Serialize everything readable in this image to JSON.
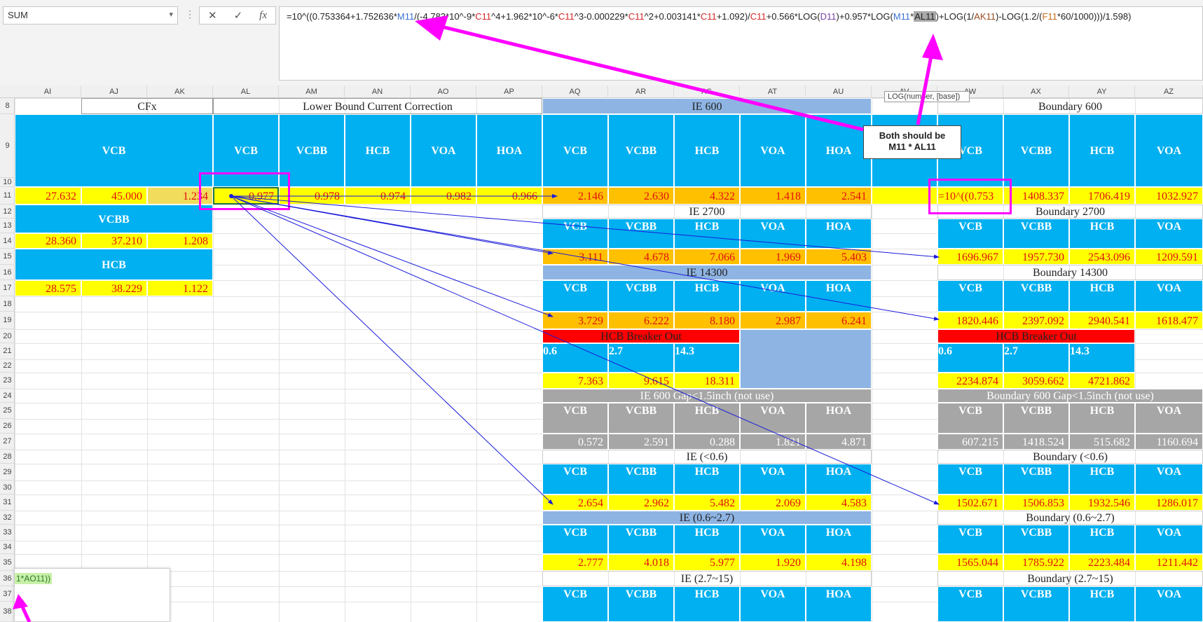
{
  "namebox": {
    "value": "SUM"
  },
  "formula_bar": {
    "cancel_icon": "✕",
    "enter_icon": "✓",
    "fx_icon": "fx",
    "formula_parts": [
      {
        "t": "=10^((0.753364+1.752636*",
        "c": ""
      },
      {
        "t": "M11",
        "c": "fblue"
      },
      {
        "t": "/(-4.783*10^-9*",
        "c": ""
      },
      {
        "t": "C11",
        "c": "fred"
      },
      {
        "t": "^4+1.962*10^-6*",
        "c": ""
      },
      {
        "t": "C11",
        "c": "fred"
      },
      {
        "t": "^3-0.000229*",
        "c": ""
      },
      {
        "t": "C11",
        "c": "fred"
      },
      {
        "t": "^2+0.003141*",
        "c": ""
      },
      {
        "t": "C11",
        "c": "fred"
      },
      {
        "t": "+1.092)/",
        "c": ""
      },
      {
        "t": "C11",
        "c": "fred"
      },
      {
        "t": "+0.566*LOG(",
        "c": ""
      },
      {
        "t": "D11",
        "c": "fpurple"
      },
      {
        "t": ")+0.957*LOG(",
        "c": ""
      },
      {
        "t": "M11",
        "c": "fblue"
      },
      {
        "t": "*",
        "c": ""
      },
      {
        "t": "AL11",
        "c": "fhl"
      },
      {
        "t": ")+LOG(1/",
        "c": ""
      },
      {
        "t": "AK11",
        "c": "fbrown"
      },
      {
        "t": ")-LOG(1.2/(",
        "c": ""
      },
      {
        "t": "F11",
        "c": "forange"
      },
      {
        "t": "*60/1000)))/1.598)",
        "c": ""
      }
    ]
  },
  "tooltip": "LOG(number, [base])",
  "callout": {
    "line1": "Both should be",
    "line2": "M11 * AL11"
  },
  "popup_text": "1*AO11))",
  "columns": [
    "AI",
    "AJ",
    "AK",
    "AL",
    "AM",
    "AN",
    "AO",
    "AP",
    "AQ",
    "AR",
    "AS",
    "AT",
    "AU",
    "AV",
    "AW",
    "AX",
    "AY",
    "AZ"
  ],
  "rows": [
    "8",
    "9",
    "10",
    "11",
    "12",
    "13",
    "14",
    "15",
    "16",
    "17",
    "18",
    "19",
    "20",
    "21",
    "22",
    "23",
    "24",
    "25",
    "26",
    "27",
    "28",
    "29",
    "30",
    "31",
    "32",
    "33",
    "34",
    "35",
    "36",
    "37",
    "38"
  ],
  "sections": {
    "cfx_title": "CFx",
    "lbcc_title": "Lower Bound Current Correction",
    "ie600": "IE 600",
    "boundary600": "Boundary 600",
    "ie2700": "IE 2700",
    "boundary2700": "Boundary 2700",
    "ie14300": "IE 14300",
    "boundary14300": "Boundary 14300",
    "hcb_out": "HCB Breaker Out",
    "ie600gap": "IE 600 Gap<1.5inch (not use)",
    "b600gap": "Boundary 600 Gap<1.5inch (not use)",
    "ie_lt06": "IE (<0.6)",
    "b_lt06": "Boundary (<0.6)",
    "ie_06_27": "IE (0.6~2.7)",
    "b_06_27": "Boundary (0.6~2.7)",
    "ie_27_15": "IE (2.7~15)",
    "b_27_15": "Boundary (2.7~15)"
  },
  "labels": {
    "vcb": "VCB",
    "vcbb": "VCBB",
    "hcb": "HCB",
    "voa": "VOA",
    "hoa": "HOA",
    "h06": "0.6",
    "h27": "2.7",
    "h143": "14.3"
  },
  "cfx": {
    "vcb": [
      "27.632",
      "45.000",
      "1.234"
    ],
    "vcbb": [
      "28.360",
      "37.210",
      "1.208"
    ],
    "hcb": [
      "28.575",
      "38.229",
      "1.122"
    ]
  },
  "lbcc_values": [
    "0.977",
    "0.978",
    "0.974",
    "0.982",
    "0.966"
  ],
  "ie600_values": [
    "2.146",
    "2.630",
    "4.322",
    "1.418",
    "2.541"
  ],
  "b600_values": [
    "=10^((0.753",
    "1408.337",
    "1706.419",
    "1032.927"
  ],
  "ie2700_values": [
    "3.111",
    "4.678",
    "7.066",
    "1.969",
    "5.403"
  ],
  "b2700_values": [
    "1696.967",
    "1957.730",
    "2543.096",
    "1209.591"
  ],
  "ie14300_values": [
    "3.729",
    "6.222",
    "8.180",
    "2.987",
    "6.241"
  ],
  "b14300_values": [
    "1820.446",
    "2397.092",
    "2940.541",
    "1618.477"
  ],
  "hcbout_ie_values": [
    "7.363",
    "9.615",
    "18.311"
  ],
  "hcbout_b_values": [
    "2234.874",
    "3059.662",
    "4721.862"
  ],
  "ie600gap_values": [
    "0.572",
    "2.591",
    "0.288",
    "1.821",
    "4.871"
  ],
  "b600gap_values": [
    "607.215",
    "1418.524",
    "515.682",
    "1160.694"
  ],
  "ie_lt06_values": [
    "2.654",
    "2.962",
    "5.482",
    "2.069",
    "4.583"
  ],
  "b_lt06_values": [
    "1502.671",
    "1506.853",
    "1932.546",
    "1286.017"
  ],
  "ie_06_27_values": [
    "2.777",
    "4.018",
    "5.977",
    "1.920",
    "4.198"
  ],
  "b_06_27_values": [
    "1565.044",
    "1785.922",
    "2223.484",
    "1211.442"
  ],
  "colors": {
    "blue": "#00b0f0",
    "yellow": "#ffff00",
    "orange": "#ffc000",
    "red": "#ff0000",
    "gray": "#a6a6a6",
    "lightblue": "#8eb4e3",
    "magenta": "#ff00ff",
    "arrow": "#1a1adb"
  }
}
